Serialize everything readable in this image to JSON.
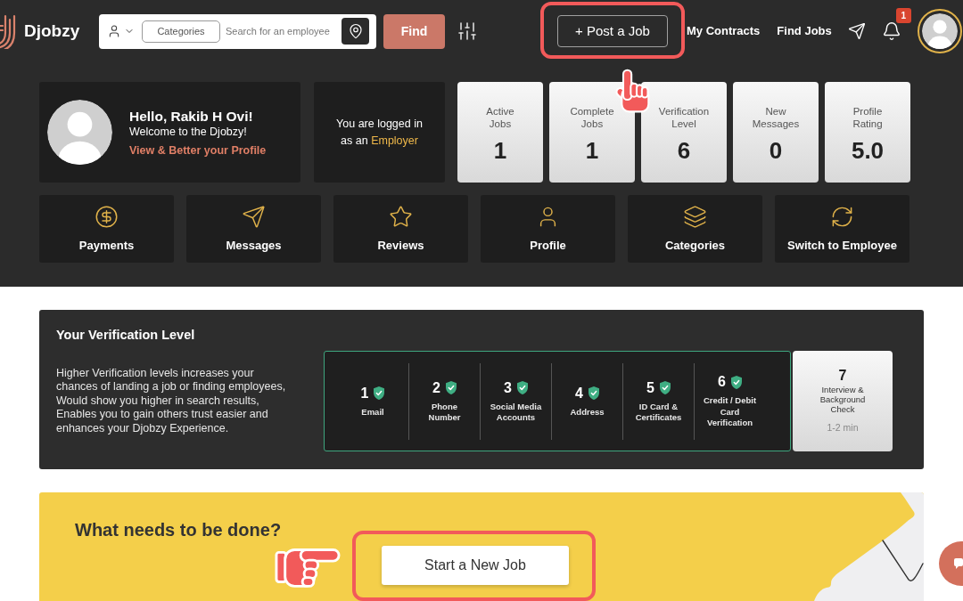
{
  "header": {
    "logo": "Djobzy",
    "search": {
      "category_button": "Categories",
      "placeholder": "Search for an employee"
    },
    "find_button": "Find",
    "post_job_button": "+ Post a Job",
    "nav_links": [
      "My Contracts",
      "Find Jobs"
    ],
    "notification_count": "1"
  },
  "profile_card": {
    "greeting": "Hello, Rakib H Ovi!",
    "welcome": "Welcome to the Djobzy!",
    "profile_link": "View & Better your Profile"
  },
  "login_status": {
    "text": "You are logged in as an",
    "role": "Employer"
  },
  "stats": [
    {
      "label": "Active Jobs",
      "value": "1"
    },
    {
      "label": "Complete Jobs",
      "value": "1"
    },
    {
      "label": "Verification Level",
      "value": "6"
    },
    {
      "label": "New Messages",
      "value": "0"
    },
    {
      "label": "Profile Rating",
      "value": "5.0"
    }
  ],
  "shortcuts": [
    "Payments",
    "Messages",
    "Reviews",
    "Profile",
    "Categories",
    "Switch to Employee"
  ],
  "verification": {
    "title": "Your Verification Level",
    "description": "Higher Verification levels increases your chances of landing a job or finding employees, Would show you higher in search results, Enables you to gain others trust easier and enhances your Djobzy Experience.",
    "steps": [
      {
        "number": "1",
        "label_lines": [
          "Email"
        ],
        "verified": true
      },
      {
        "number": "2",
        "label_lines": [
          "Phone",
          "Number"
        ],
        "verified": true
      },
      {
        "number": "3",
        "label_lines": [
          "Social Media",
          "Accounts"
        ],
        "verified": true
      },
      {
        "number": "4",
        "label_lines": [
          "Address"
        ],
        "verified": true
      },
      {
        "number": "5",
        "label_lines": [
          "ID Card &",
          "Certificates"
        ],
        "verified": true
      },
      {
        "number": "6",
        "label_lines": [
          "Credit / Debit",
          "Card",
          "Verification"
        ],
        "verified": true
      },
      {
        "number": "7",
        "label_lines": [
          "Interview &",
          "Background",
          "Check"
        ],
        "verified": false,
        "duration": "1-2 min"
      }
    ]
  },
  "banner": {
    "title": "What needs to be done?",
    "button": "Start a New Job"
  }
}
